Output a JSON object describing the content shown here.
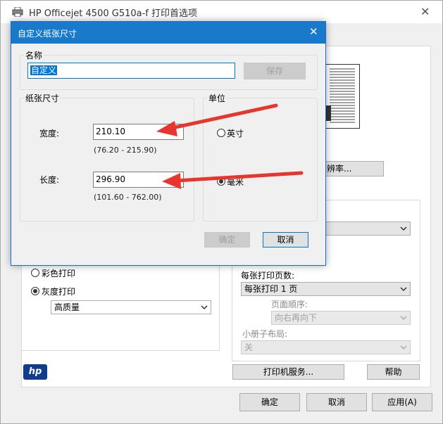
{
  "parent_window": {
    "title": "HP Officejet 4500 G510a-f 打印首选项",
    "color_print_label": "彩色打印",
    "grayscale_print_label": "灰度打印",
    "quality_select": "高质量",
    "pages_per_sheet_label": "每张打印页数:",
    "pages_per_sheet_select": "每张打印 1 页",
    "page_order_label": "页面顺序:",
    "page_order_select": "向右再向下",
    "booklet_label": "小册子布局:",
    "booklet_select": "关",
    "resolution_button_partial": "辨率...",
    "printer_services_button": "打印机服务...",
    "help_button": "帮助",
    "ok_button": "确定",
    "cancel_button": "取消",
    "apply_button": "应用(A)",
    "logo_text": "hp"
  },
  "dialog": {
    "title": "自定义纸张尺寸",
    "name_group_label": "名称",
    "name_value": "自定义",
    "save_button": "保存",
    "size_group_label": "纸张尺寸",
    "width_label": "宽度:",
    "width_value": "210.10",
    "width_range": "(76.20 - 215.90)",
    "length_label": "长度:",
    "length_value": "296.90",
    "length_range": "(101.60 - 762.00)",
    "unit_group_label": "单位",
    "unit_inch": "英寸",
    "unit_mm": "毫米",
    "selected_unit": "mm",
    "ok_button": "确定",
    "cancel_button": "取消"
  },
  "annotation": {
    "arrow_color": "#e8352e"
  },
  "colors": {
    "dialog_titlebar": "#1979ca",
    "selection": "#0078d7"
  }
}
